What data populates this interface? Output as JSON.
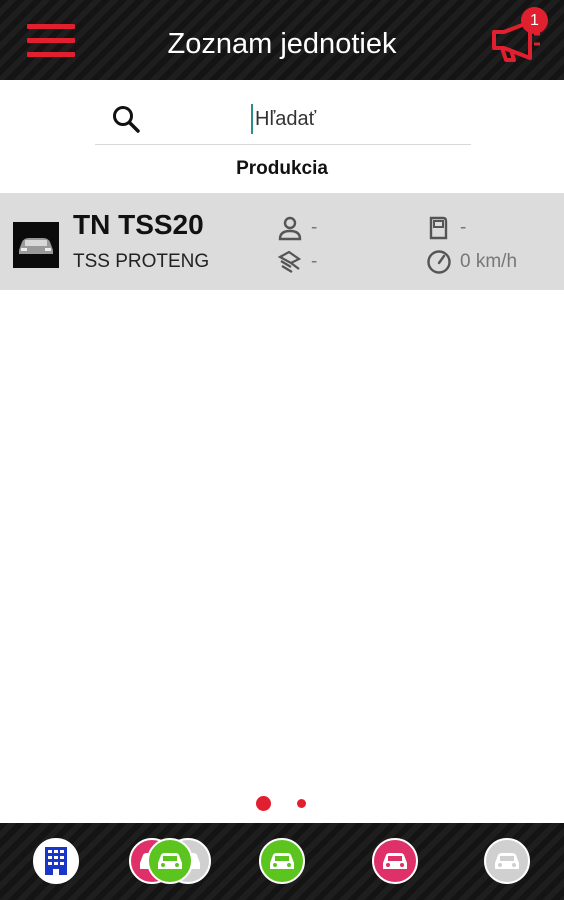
{
  "header": {
    "title": "Zoznam jednotiek",
    "notification_count": "1",
    "accent_color": "#e0202e"
  },
  "search": {
    "placeholder": "Hľadať",
    "value": ""
  },
  "section": {
    "label": "Produkcia"
  },
  "units": [
    {
      "name": "TN TSS20",
      "company": "TSS PROTENG",
      "driver": "-",
      "fuel": "-",
      "tachograph": "-",
      "speed": "0 km/h"
    }
  ],
  "pager": {
    "pages": 2,
    "current": 1
  },
  "bottom_nav": [
    {
      "icon": "building-icon",
      "color": "#1a36c8"
    },
    {
      "icon": "car-group-icon",
      "colors": [
        "#e0306a",
        "#5cc41e",
        "#d0d0d0"
      ]
    },
    {
      "icon": "car-icon",
      "color": "#5cc41e"
    },
    {
      "icon": "car-icon",
      "color": "#e0306a"
    },
    {
      "icon": "car-icon",
      "color": "#d0d0d0"
    }
  ]
}
